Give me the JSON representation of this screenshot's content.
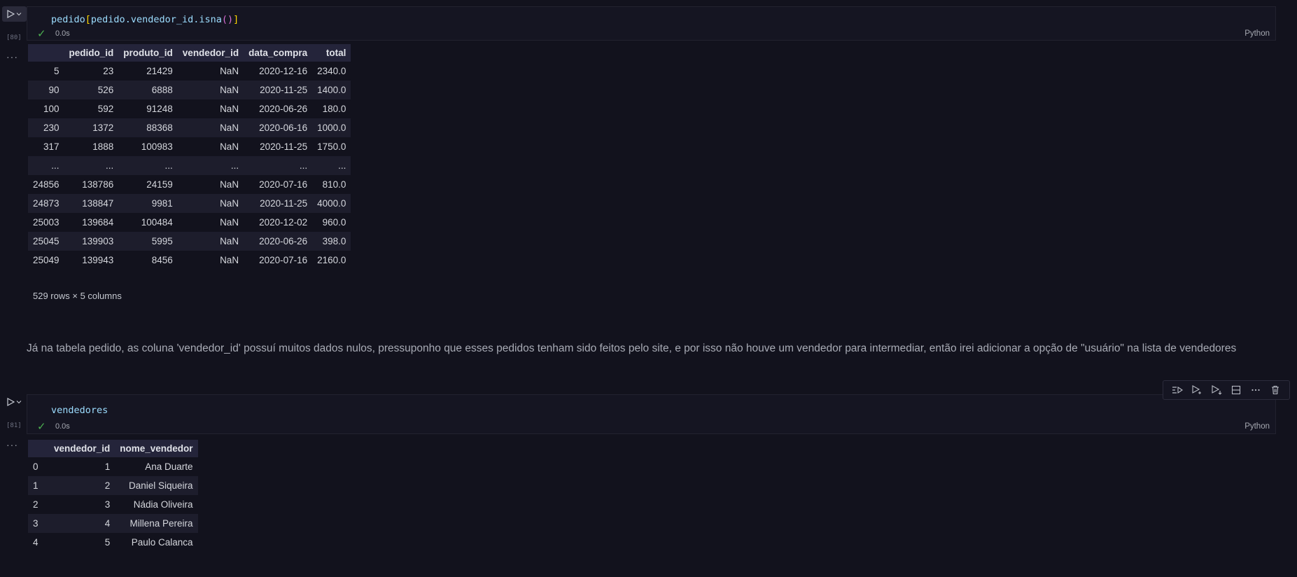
{
  "cell80": {
    "exec_count": "[80]",
    "code_prefix": "pedido",
    "code_bracket_open": "[",
    "code_inner": "pedido.vendedor_id.isna",
    "code_paren": "()",
    "code_bracket_close": "]",
    "status_time": "0.0s",
    "language": "Python",
    "output": {
      "columns": [
        "",
        "pedido_id",
        "produto_id",
        "vendedor_id",
        "data_compra",
        "total"
      ],
      "rows": [
        [
          "5",
          "23",
          "21429",
          "NaN",
          "2020-12-16",
          "2340.0"
        ],
        [
          "90",
          "526",
          "6888",
          "NaN",
          "2020-11-25",
          "1400.0"
        ],
        [
          "100",
          "592",
          "91248",
          "NaN",
          "2020-06-26",
          "180.0"
        ],
        [
          "230",
          "1372",
          "88368",
          "NaN",
          "2020-06-16",
          "1000.0"
        ],
        [
          "317",
          "1888",
          "100983",
          "NaN",
          "2020-11-25",
          "1750.0"
        ],
        [
          "...",
          "...",
          "...",
          "...",
          "...",
          "..."
        ],
        [
          "24856",
          "138786",
          "24159",
          "NaN",
          "2020-07-16",
          "810.0"
        ],
        [
          "24873",
          "138847",
          "9981",
          "NaN",
          "2020-11-25",
          "4000.0"
        ],
        [
          "25003",
          "139684",
          "100484",
          "NaN",
          "2020-12-02",
          "960.0"
        ],
        [
          "25045",
          "139903",
          "5995",
          "NaN",
          "2020-06-26",
          "398.0"
        ],
        [
          "25049",
          "139943",
          "8456",
          "NaN",
          "2020-07-16",
          "2160.0"
        ]
      ],
      "shape": "529 rows × 5 columns"
    }
  },
  "markdown": {
    "text": "Já na tabela pedido, as coluna 'vendedor_id' possuí muitos dados nulos, pressuponho que esses pedidos tenham sido feitos pelo site, e por isso não houve um vendedor para intermediar, então irei adicionar a opção de \"usuário\" na lista de vendedores"
  },
  "cell81": {
    "exec_count": "[81]",
    "code": "vendedores",
    "status_time": "0.0s",
    "language": "Python",
    "output": {
      "columns": [
        "",
        "vendedor_id",
        "nome_vendedor"
      ],
      "rows": [
        [
          "0",
          "1",
          "Ana Duarte"
        ],
        [
          "1",
          "2",
          "Daniel Siqueira"
        ],
        [
          "2",
          "3",
          "Nádia Oliveira"
        ],
        [
          "3",
          "4",
          "Millena Pereira"
        ],
        [
          "4",
          "5",
          "Paulo Calanca"
        ]
      ]
    }
  },
  "icons": {
    "run": "play-icon",
    "more_run": "chevron-down-icon",
    "success": "check-icon",
    "output_menu": "ellipsis-icon",
    "toolbar": [
      "execute-above-icon",
      "execute-cell-below-icon",
      "execute-below-icon",
      "split-cell-icon",
      "more-icon",
      "delete-icon"
    ]
  },
  "colors": {
    "background": "#12121d",
    "cell_bg": "#151522",
    "code_identifier": "#9cdcfe",
    "bracket_1": "#ffd700",
    "bracket_2": "#da70d6",
    "success": "#4caf50",
    "table_header": "#24243a"
  }
}
